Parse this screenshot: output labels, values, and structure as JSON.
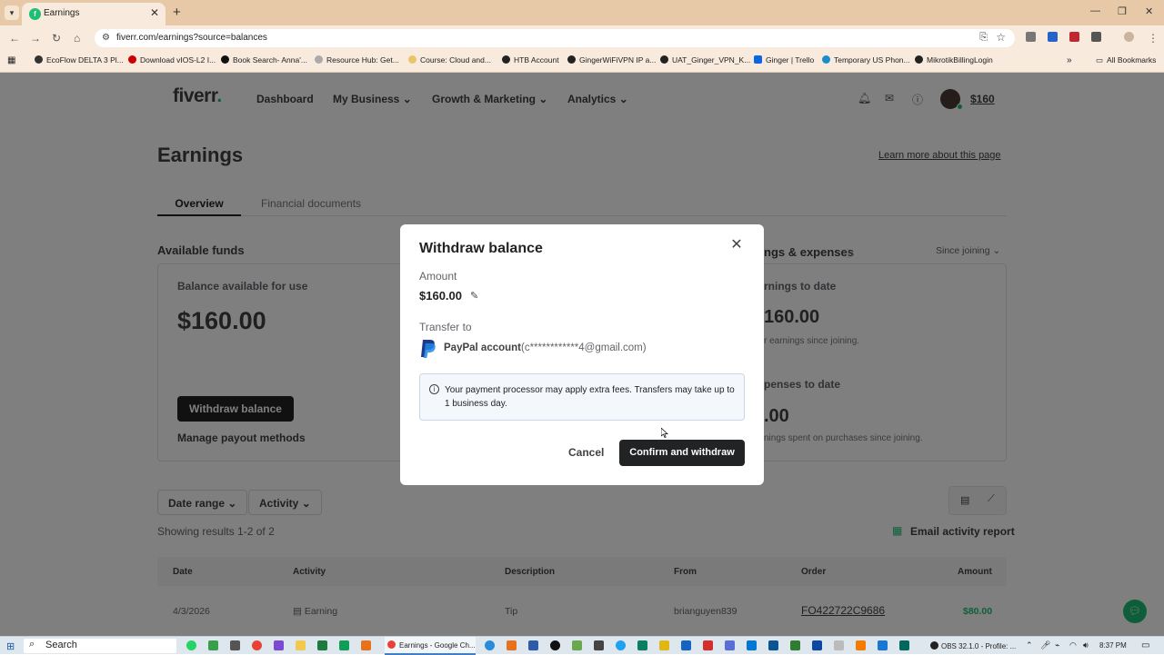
{
  "browser": {
    "tab_title": "Earnings",
    "url": "fiverr.com/earnings?source=balances",
    "bookmarks": [
      "EcoFlow DELTA 3 Pl...",
      "Download vIOS-L2 I...",
      "Book Search- Anna'...",
      "Resource Hub: Get...",
      "Course: Cloud and...",
      "HTB Account",
      "GingerWiFiVPN IP a...",
      "UAT_Ginger_VPN_K...",
      "Ginger | Trello",
      "Temporary US Phon...",
      "MikrotikBillingLogin"
    ],
    "all_bookmarks": "All Bookmarks"
  },
  "header": {
    "logo": "fiverr",
    "logo_dot": ".",
    "nav": [
      "Dashboard",
      "My Business",
      "Growth & Marketing",
      "Analytics"
    ],
    "balance": "$160"
  },
  "page": {
    "title": "Earnings",
    "learn_more": "Learn more about this page",
    "tabs": [
      "Overview",
      "Financial documents"
    ],
    "available_funds": {
      "title": "Available funds",
      "label": "Balance available for use",
      "amount": "$160.00",
      "withdraw_btn": "Withdraw balance",
      "manage": "Manage payout methods"
    },
    "earnings_panel": {
      "title": "ngs & expenses",
      "period": "Since joining",
      "earnings_label": "rnings to date",
      "earnings_value": "160.00",
      "earnings_note": "r earnings since joining.",
      "expenses_label": "penses to date",
      "expenses_value": ".00",
      "expenses_note": "nings spent on purchases since joining."
    },
    "filters": [
      "Date range",
      "Activity"
    ],
    "results": "Showing results 1-2 of 2",
    "email_report": "Email activity report",
    "table": {
      "headers": [
        "Date",
        "Activity",
        "Description",
        "From",
        "Order",
        "Amount"
      ],
      "rows": [
        {
          "date": "4/3/2026",
          "activity": "Earning",
          "description": "Tip",
          "from": "brianguyen839",
          "order": "FO422722C9686",
          "amount": "$80.00"
        }
      ]
    }
  },
  "modal": {
    "title": "Withdraw balance",
    "amount_label": "Amount",
    "amount": "$160.00",
    "transfer_label": "Transfer to",
    "method": "PayPal account",
    "email": "(c************4@gmail.com)",
    "notice": "Your payment processor may apply extra fees. Transfers may take up to 1 business day.",
    "cancel": "Cancel",
    "confirm": "Confirm and withdraw"
  },
  "taskbar": {
    "search": "Search",
    "active_app": "Earnings - Google Ch...",
    "obs": "OBS 32.1.0 - Profile: ...",
    "time": "8:37 PM"
  },
  "colors": {
    "brand_green": "#1dbf73",
    "button_dark": "#222325",
    "chrome_tab": "#e7c9a7"
  }
}
